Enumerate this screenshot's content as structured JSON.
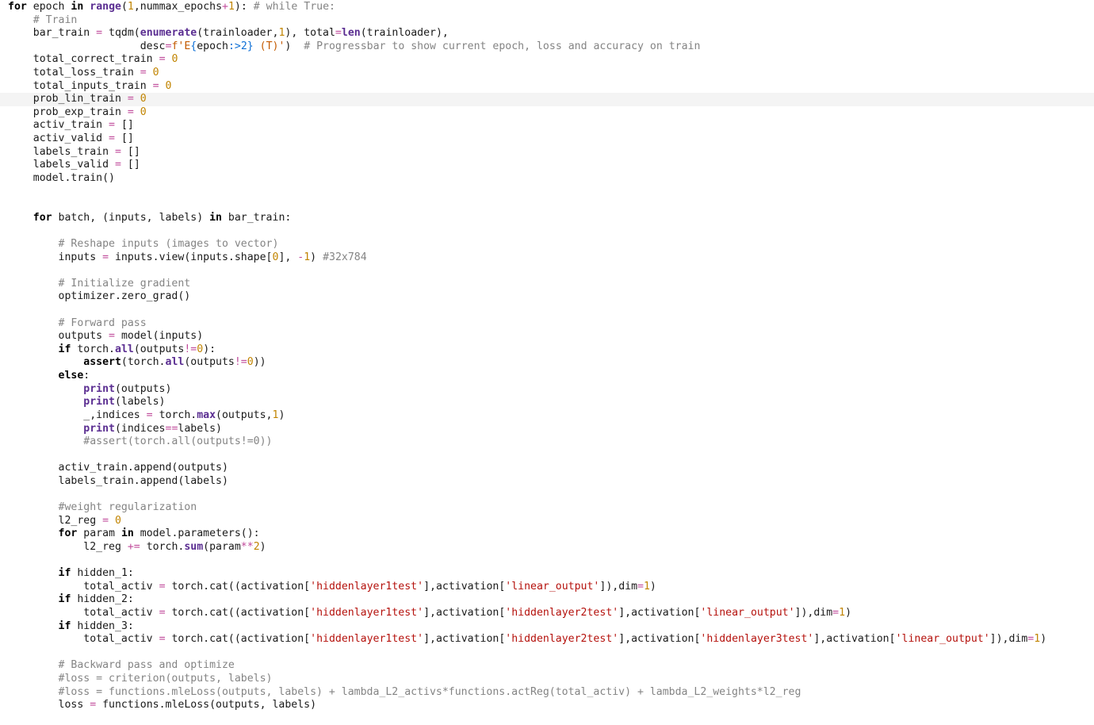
{
  "editor": {
    "active_line": 7,
    "lines": [
      [
        [
          "kw",
          "for"
        ],
        [
          "id",
          " epoch "
        ],
        [
          "kw",
          "in"
        ],
        [
          "id",
          " "
        ],
        [
          "bi",
          "range"
        ],
        [
          "id",
          "("
        ],
        [
          "num",
          "1"
        ],
        [
          "id",
          ",nummax_epochs"
        ],
        [
          "op",
          "+"
        ],
        [
          "num",
          "1"
        ],
        [
          "id",
          "): "
        ],
        [
          "cm",
          "# while True:"
        ]
      ],
      [
        [
          "cm",
          "    # Train"
        ]
      ],
      [
        [
          "id",
          "    bar_train "
        ],
        [
          "op",
          "="
        ],
        [
          "id",
          " tqdm("
        ],
        [
          "bi",
          "enumerate"
        ],
        [
          "id",
          "(trainloader,"
        ],
        [
          "num",
          "1"
        ],
        [
          "id",
          "), total"
        ],
        [
          "op",
          "="
        ],
        [
          "bi",
          "len"
        ],
        [
          "id",
          "(trainloader),"
        ]
      ],
      [
        [
          "id",
          "                     desc"
        ],
        [
          "op",
          "="
        ],
        [
          "fst",
          "f'E"
        ],
        [
          "brace",
          "{"
        ],
        [
          "id",
          "epoch"
        ],
        [
          "brace",
          ":>2}"
        ],
        [
          "fst",
          " (T)'"
        ],
        [
          "id",
          ")  "
        ],
        [
          "cm",
          "# Progressbar to show current epoch, loss and accuracy on train"
        ]
      ],
      [
        [
          "id",
          "    total_correct_train "
        ],
        [
          "op",
          "="
        ],
        [
          "id",
          " "
        ],
        [
          "num",
          "0"
        ]
      ],
      [
        [
          "id",
          "    total_loss_train "
        ],
        [
          "op",
          "="
        ],
        [
          "id",
          " "
        ],
        [
          "num",
          "0"
        ]
      ],
      [
        [
          "id",
          "    total_inputs_train "
        ],
        [
          "op",
          "="
        ],
        [
          "id",
          " "
        ],
        [
          "num",
          "0"
        ]
      ],
      [
        [
          "id",
          "    prob_lin_train "
        ],
        [
          "op",
          "="
        ],
        [
          "id",
          " "
        ],
        [
          "num",
          "0"
        ]
      ],
      [
        [
          "id",
          "    prob_exp_train "
        ],
        [
          "op",
          "="
        ],
        [
          "id",
          " "
        ],
        [
          "num",
          "0"
        ]
      ],
      [
        [
          "id",
          "    activ_train "
        ],
        [
          "op",
          "="
        ],
        [
          "id",
          " []"
        ]
      ],
      [
        [
          "id",
          "    activ_valid "
        ],
        [
          "op",
          "="
        ],
        [
          "id",
          " []"
        ]
      ],
      [
        [
          "id",
          "    labels_train "
        ],
        [
          "op",
          "="
        ],
        [
          "id",
          " []"
        ]
      ],
      [
        [
          "id",
          "    labels_valid "
        ],
        [
          "op",
          "="
        ],
        [
          "id",
          " []"
        ]
      ],
      [
        [
          "id",
          "    model.train()"
        ]
      ],
      [],
      [],
      [
        [
          "id",
          "    "
        ],
        [
          "kw",
          "for"
        ],
        [
          "id",
          " batch, (inputs, labels) "
        ],
        [
          "kw",
          "in"
        ],
        [
          "id",
          " bar_train:"
        ]
      ],
      [],
      [
        [
          "cm",
          "        # Reshape inputs (images to vector)"
        ]
      ],
      [
        [
          "id",
          "        inputs "
        ],
        [
          "op",
          "="
        ],
        [
          "id",
          " inputs.view(inputs.shape["
        ],
        [
          "num",
          "0"
        ],
        [
          "id",
          "], "
        ],
        [
          "op",
          "-"
        ],
        [
          "num",
          "1"
        ],
        [
          "id",
          ") "
        ],
        [
          "cm",
          "#32x784"
        ]
      ],
      [],
      [
        [
          "cm",
          "        # Initialize gradient"
        ]
      ],
      [
        [
          "id",
          "        optimizer.zero_grad()"
        ]
      ],
      [],
      [
        [
          "cm",
          "        # Forward pass"
        ]
      ],
      [
        [
          "id",
          "        outputs "
        ],
        [
          "op",
          "="
        ],
        [
          "id",
          " model(inputs)"
        ]
      ],
      [
        [
          "id",
          "        "
        ],
        [
          "kw",
          "if"
        ],
        [
          "id",
          " torch."
        ],
        [
          "bi",
          "all"
        ],
        [
          "id",
          "(outputs"
        ],
        [
          "op",
          "!="
        ],
        [
          "num",
          "0"
        ],
        [
          "id",
          "):"
        ]
      ],
      [
        [
          "id",
          "            "
        ],
        [
          "kw",
          "assert"
        ],
        [
          "id",
          "(torch."
        ],
        [
          "bi",
          "all"
        ],
        [
          "id",
          "(outputs"
        ],
        [
          "op",
          "!="
        ],
        [
          "num",
          "0"
        ],
        [
          "id",
          "))"
        ]
      ],
      [
        [
          "id",
          "        "
        ],
        [
          "kw",
          "else"
        ],
        [
          "id",
          ":"
        ]
      ],
      [
        [
          "id",
          "            "
        ],
        [
          "bi",
          "print"
        ],
        [
          "id",
          "(outputs)"
        ]
      ],
      [
        [
          "id",
          "            "
        ],
        [
          "bi",
          "print"
        ],
        [
          "id",
          "(labels)"
        ]
      ],
      [
        [
          "id",
          "            _,indices "
        ],
        [
          "op",
          "="
        ],
        [
          "id",
          " torch."
        ],
        [
          "bi",
          "max"
        ],
        [
          "id",
          "(outputs,"
        ],
        [
          "num",
          "1"
        ],
        [
          "id",
          ")"
        ]
      ],
      [
        [
          "id",
          "            "
        ],
        [
          "bi",
          "print"
        ],
        [
          "id",
          "(indices"
        ],
        [
          "op",
          "=="
        ],
        [
          "id",
          "labels)"
        ]
      ],
      [
        [
          "cm",
          "            #assert(torch.all(outputs!=0))"
        ]
      ],
      [],
      [
        [
          "id",
          "        activ_train.append(outputs)"
        ]
      ],
      [
        [
          "id",
          "        labels_train.append(labels)"
        ]
      ],
      [],
      [
        [
          "cm",
          "        #weight regularization"
        ]
      ],
      [
        [
          "id",
          "        l2_reg "
        ],
        [
          "op",
          "="
        ],
        [
          "id",
          " "
        ],
        [
          "num",
          "0"
        ]
      ],
      [
        [
          "id",
          "        "
        ],
        [
          "kw",
          "for"
        ],
        [
          "id",
          " param "
        ],
        [
          "kw",
          "in"
        ],
        [
          "id",
          " model.parameters():"
        ]
      ],
      [
        [
          "id",
          "            l2_reg "
        ],
        [
          "op",
          "+="
        ],
        [
          "id",
          " torch."
        ],
        [
          "bi",
          "sum"
        ],
        [
          "id",
          "(param"
        ],
        [
          "op",
          "**"
        ],
        [
          "num",
          "2"
        ],
        [
          "id",
          ")"
        ]
      ],
      [],
      [
        [
          "id",
          "        "
        ],
        [
          "kw",
          "if"
        ],
        [
          "id",
          " hidden_1:"
        ]
      ],
      [
        [
          "id",
          "            total_activ "
        ],
        [
          "op",
          "="
        ],
        [
          "id",
          " torch.cat((activation["
        ],
        [
          "str",
          "'hiddenlayer1test'"
        ],
        [
          "id",
          "],activation["
        ],
        [
          "str",
          "'linear_output'"
        ],
        [
          "id",
          "]),dim"
        ],
        [
          "op",
          "="
        ],
        [
          "num",
          "1"
        ],
        [
          "id",
          ")"
        ]
      ],
      [
        [
          "id",
          "        "
        ],
        [
          "kw",
          "if"
        ],
        [
          "id",
          " hidden_2:"
        ]
      ],
      [
        [
          "id",
          "            total_activ "
        ],
        [
          "op",
          "="
        ],
        [
          "id",
          " torch.cat((activation["
        ],
        [
          "str",
          "'hiddenlayer1test'"
        ],
        [
          "id",
          "],activation["
        ],
        [
          "str",
          "'hiddenlayer2test'"
        ],
        [
          "id",
          "],activation["
        ],
        [
          "str",
          "'linear_output'"
        ],
        [
          "id",
          "]),dim"
        ],
        [
          "op",
          "="
        ],
        [
          "num",
          "1"
        ],
        [
          "id",
          ")"
        ]
      ],
      [
        [
          "id",
          "        "
        ],
        [
          "kw",
          "if"
        ],
        [
          "id",
          " hidden_3:"
        ]
      ],
      [
        [
          "id",
          "            total_activ "
        ],
        [
          "op",
          "="
        ],
        [
          "id",
          " torch.cat((activation["
        ],
        [
          "str",
          "'hiddenlayer1test'"
        ],
        [
          "id",
          "],activation["
        ],
        [
          "str",
          "'hiddenlayer2test'"
        ],
        [
          "id",
          "],activation["
        ],
        [
          "str",
          "'hiddenlayer3test'"
        ],
        [
          "id",
          "],activation["
        ],
        [
          "str",
          "'linear_output'"
        ],
        [
          "id",
          "]),dim"
        ],
        [
          "op",
          "="
        ],
        [
          "num",
          "1"
        ],
        [
          "id",
          ")"
        ]
      ],
      [],
      [
        [
          "cm",
          "        # Backward pass and optimize"
        ]
      ],
      [
        [
          "cm",
          "        #loss = criterion(outputs, labels)"
        ]
      ],
      [
        [
          "cm",
          "        #loss = functions.mleLoss(outputs, labels) + lambda_L2_activs*functions.actReg(total_activ) + lambda_L2_weights*l2_reg"
        ]
      ],
      [
        [
          "id",
          "        loss "
        ],
        [
          "op",
          "="
        ],
        [
          "id",
          " functions.mleLoss(outputs, labels)"
        ]
      ]
    ]
  }
}
